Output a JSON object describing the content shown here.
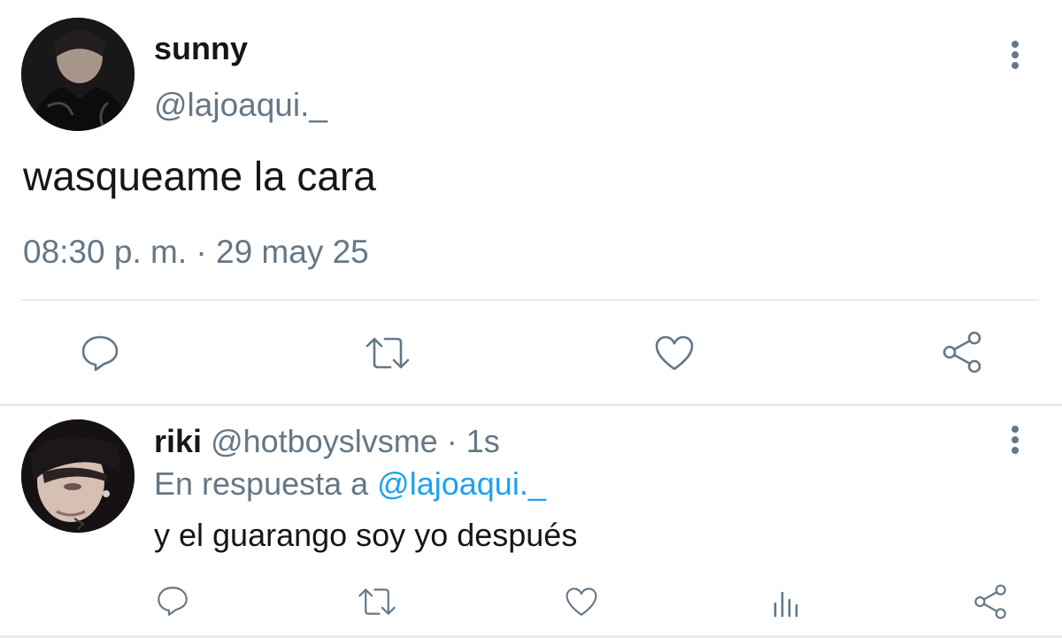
{
  "tweet": {
    "author_name": "sunny",
    "author_handle": "@lajoaqui._",
    "text": "wasqueame la cara",
    "timestamp": "08:30 p. m. · 29 may 25"
  },
  "reply": {
    "author_name": "riki",
    "author_handle": "@hotboyslvsme",
    "separator": " · ",
    "age": "1s",
    "reply_prefix": "En respuesta a ",
    "reply_mention": "@lajoaqui._",
    "text": "y el guarango soy yo después"
  },
  "icons": {
    "reply": "reply-icon",
    "retweet": "retweet-icon",
    "like": "heart-icon",
    "share": "share-icon",
    "analytics": "analytics-icon",
    "more": "more-vertical-icon"
  },
  "colors": {
    "text_primary": "#14171a",
    "text_secondary": "#657786",
    "mention": "#1da1f2",
    "divider": "#e6ecf0"
  }
}
